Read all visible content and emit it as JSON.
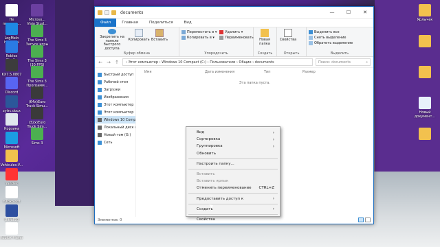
{
  "desktop": {
    "icons_left": [
      {
        "label": "Не подтвер... 86415...",
        "icon": "file-icon",
        "color": "#ffffff"
      },
      {
        "label": "LogMeIn Hamachi",
        "icon": "hamachi-icon",
        "color": "#1e88e5"
      },
      {
        "label": "Roblox Studio",
        "icon": "roblox-studio-icon",
        "color": "#2a7be4"
      },
      {
        "label": "KX7.5.0807",
        "icon": "app-icon",
        "color": "#3c3c3c"
      },
      {
        "label": "Discord",
        "icon": "discord-icon",
        "color": "#5865f2"
      },
      {
        "label": "zytrc.docx",
        "icon": "word-icon",
        "color": "#2b579a"
      },
      {
        "label": "Корзина",
        "icon": "recycle-bin-icon",
        "color": "#dfe6ee"
      },
      {
        "label": "Microsoft Edge",
        "icon": "edge-icon",
        "color": "#1b9de2"
      },
      {
        "label": "Vehicules-V...",
        "icon": "folder-icon",
        "color": "#f2c14e"
      },
      {
        "label": "Yandex",
        "icon": "yandex-icon",
        "color": "#ff3333"
      },
      {
        "label": "n7b​xo.odt",
        "icon": "document-icon",
        "color": "#ffffff"
      },
      {
        "label": "UltraISO",
        "icon": "ultraiso-icon",
        "color": "#2d4fa0"
      },
      {
        "label": "Roblox Player",
        "icon": "roblox-icon",
        "color": "#ffffff"
      }
    ],
    "icons_left_col2": [
      {
        "label": "Microso... Visio Stud...",
        "icon": "visio-icon",
        "color": "#6b3fa0"
      },
      {
        "label": "The Sims 3 Запуск игры",
        "icon": "sims-icon",
        "color": "#4caf50"
      },
      {
        "label": "The Sims 3 (30 FPS)",
        "icon": "sims-icon",
        "color": "#4caf50"
      },
      {
        "label": "The Sims 3 Программ...",
        "icon": "sims-icon",
        "color": "#4caf50"
      },
      {
        "label": "(64x)Euro Truck Simu...",
        "icon": "ets-icon",
        "color": "#3a3a3a"
      },
      {
        "label": "(32x)Euro Truck Sim...",
        "icon": "ets-icon",
        "color": "#3a3a3a"
      },
      {
        "label": "Sims 3",
        "icon": "sims-icon",
        "color": "#4caf50"
      }
    ],
    "icons_right": [
      {
        "label": "Ярлычек",
        "icon": "shortcut-icon",
        "color": "#f2c14e"
      },
      {
        "label": "",
        "icon": "folder-icon",
        "color": "#f2c14e"
      },
      {
        "label": "",
        "icon": "folder-icon",
        "color": "#f2c14e"
      },
      {
        "label": "Новый документ...",
        "icon": "text-document-icon",
        "color": "#e8f1fb"
      },
      {
        "label": "",
        "icon": "folder-icon",
        "color": "#f2c14e"
      }
    ]
  },
  "window": {
    "title": "documents",
    "controls": {
      "minimize": "—",
      "maximize": "☐",
      "close": "✕"
    },
    "tabs": [
      "Файл",
      "Главная",
      "Поделиться",
      "Вид"
    ],
    "ribbon": {
      "clipboard": {
        "pin": "Закрепить на панели быстрого доступа",
        "copy": "Копировать",
        "paste": "Вставить",
        "label": "Буфер обмена"
      },
      "organize": {
        "move_to": "Переместить в ▾",
        "copy_to": "Копировать в ▾",
        "delete": "Удалить ▾",
        "rename": "Переименовать",
        "label": "Упорядочить"
      },
      "new": {
        "new_folder": "Новая папка",
        "label": "Создать"
      },
      "open": {
        "properties": "Свойства",
        "label": "Открыть"
      },
      "select": {
        "select_all": "Выделить все",
        "select_none": "Снять выделение",
        "invert": "Обратить выделение",
        "label": "Выделить"
      }
    },
    "address": {
      "back": "←",
      "forward": "→",
      "up": "↑",
      "path": "›  Этот компьютер  ›  Windows 10 Compact (C:)  ›  Пользователи  ›  Общие  ›  documents",
      "search_placeholder": "Поиск: documents"
    },
    "nav_pane": [
      {
        "label": "Быстрый доступ",
        "icon": "star-icon",
        "color": "#3c8fd4",
        "selected": false
      },
      {
        "label": "Рабочий стол",
        "icon": "desktop-icon",
        "color": "#3c8fd4",
        "selected": false
      },
      {
        "label": "Загрузки",
        "icon": "download-icon",
        "color": "#3c8fd4",
        "selected": false
      },
      {
        "label": "Изображения",
        "icon": "pictures-icon",
        "color": "#3c8fd4",
        "selected": false
      },
      {
        "label": "Этот компьютер",
        "icon": "computer-icon",
        "color": "#3c8fd4",
        "selected": false
      },
      {
        "label": "Этот компьютер",
        "icon": "computer-icon",
        "color": "#3c8fd4",
        "selected": false
      },
      {
        "label": "Windows 10 Compa",
        "icon": "drive-icon",
        "color": "#666666",
        "selected": true
      },
      {
        "label": "Локальный диск (",
        "icon": "drive-icon",
        "color": "#666666",
        "selected": false
      },
      {
        "label": "Новый том (G:)",
        "icon": "drive-icon",
        "color": "#666666",
        "selected": false
      },
      {
        "label": "Сеть",
        "icon": "network-icon",
        "color": "#3c8fd4",
        "selected": false
      }
    ],
    "columns": [
      "Имя",
      "Дата изменения",
      "Тип",
      "Размер"
    ],
    "empty_text": "Эта папка пуста.",
    "status": "Элементов: 0"
  },
  "context_menu": {
    "items": [
      {
        "label": "Вид",
        "submenu": true,
        "disabled": false,
        "shortcut": ""
      },
      {
        "label": "Сортировка",
        "submenu": true,
        "disabled": false,
        "shortcut": ""
      },
      {
        "label": "Группировка",
        "submenu": true,
        "disabled": false,
        "shortcut": ""
      },
      {
        "label": "Обновить",
        "submenu": false,
        "disabled": false,
        "shortcut": ""
      },
      {
        "sep": true
      },
      {
        "label": "Настроить папку...",
        "submenu": false,
        "disabled": false,
        "shortcut": ""
      },
      {
        "sep": true
      },
      {
        "label": "Вставить",
        "submenu": false,
        "disabled": true,
        "shortcut": ""
      },
      {
        "label": "Вставить ярлык",
        "submenu": false,
        "disabled": true,
        "shortcut": ""
      },
      {
        "label": "Отменить переименование",
        "submenu": false,
        "disabled": false,
        "shortcut": "CTRL+Z"
      },
      {
        "sep": true
      },
      {
        "label": "Предоставить доступ к",
        "submenu": true,
        "disabled": false,
        "shortcut": ""
      },
      {
        "sep": true
      },
      {
        "label": "Создать",
        "submenu": true,
        "disabled": false,
        "shortcut": ""
      },
      {
        "sep": true
      },
      {
        "label": "Свойства",
        "submenu": false,
        "disabled": false,
        "shortcut": ""
      }
    ]
  },
  "colors": {
    "accent": "#1a73c9",
    "selection": "#cce4f7"
  }
}
